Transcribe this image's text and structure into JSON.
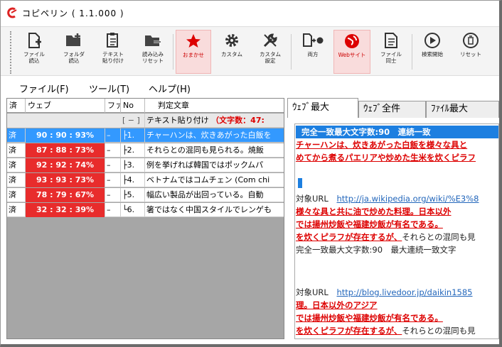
{
  "window": {
    "title": "コピペリン ( 1.1.000 )"
  },
  "ribbon": [
    {
      "name": "file-import-button",
      "icon": "file-plus",
      "label": "ファイル\n読込",
      "active": false
    },
    {
      "name": "folder-import-button",
      "icon": "folder-plus",
      "label": "フォルダ\n読込",
      "active": false
    },
    {
      "name": "text-paste-button",
      "icon": "paste",
      "label": "テキスト\n貼り付け",
      "active": false
    },
    {
      "name": "reload-reset-button",
      "icon": "folder-minus",
      "label": "読み込み\nリセット",
      "active": false
    },
    {
      "name": "omakase-button",
      "icon": "star",
      "label": "おまかせ",
      "active": true
    },
    {
      "name": "custom-button",
      "icon": "gear",
      "label": "カスタム",
      "active": false
    },
    {
      "name": "custom-settings-button",
      "icon": "wrench",
      "label": "カスタム\n設定",
      "active": false
    },
    {
      "name": "both-button",
      "icon": "doc-plus-globe",
      "label": "両方",
      "active": false
    },
    {
      "name": "website-button",
      "icon": "globe",
      "label": "Webサイト",
      "active": true
    },
    {
      "name": "file-to-file-button",
      "icon": "document",
      "label": "ファイル\n同士",
      "active": false
    },
    {
      "name": "start-check-button",
      "icon": "play",
      "label": "検索開始",
      "active": false
    },
    {
      "name": "reset-button",
      "icon": "trash",
      "label": "リセット",
      "active": false
    }
  ],
  "menu": {
    "file": "ファイル(F)",
    "tools": "ツール(T)",
    "help": "ヘルプ(H)"
  },
  "grid": {
    "headers": {
      "status": "済",
      "web": "ウェブ",
      "file": "ファ",
      "no": "No",
      "text": "判定文章"
    },
    "group_row": {
      "toggle": "[ − ]",
      "label": "テキスト貼り付け",
      "count": "（文字数：47:"
    },
    "rows": [
      {
        "status": "済",
        "pct": "90 : 90 : 93%",
        "file": "–",
        "no": "├1.",
        "text": "チャーハンは、炊きあがった白飯を"
      },
      {
        "status": "済",
        "pct": "87 : 88 : 73%",
        "file": "–",
        "no": "├2.",
        "text": "それらとの混同も見られる。焼飯"
      },
      {
        "status": "済",
        "pct": "92 : 92 : 74%",
        "file": "–",
        "no": "├3.",
        "text": "例を挙げれば韓国ではポックムパ"
      },
      {
        "status": "済",
        "pct": "93 : 93 : 73%",
        "file": "–",
        "no": "├4.",
        "text": "ベトナムではコムチェン (Com chi"
      },
      {
        "status": "済",
        "pct": "78 : 79 : 67%",
        "file": "–",
        "no": "├5.",
        "text": "幅広い製品が出回っている。自動"
      },
      {
        "status": "済",
        "pct": "32 : 32 : 39%",
        "file": "–",
        "no": "└6.",
        "text": "箸ではなく中国スタイルでレンゲも"
      }
    ]
  },
  "tabs": [
    "ｳｪﾌﾞ最大",
    "ｳｪﾌﾞ全件",
    "ﾌｧｲﾙ最大"
  ],
  "content": {
    "header": "完全一致最大文字数:90　連続一致",
    "l1": "チャーハンは、炊きあがった白飯を様々な具と",
    "l2": "めてから煮るパエリアや炒めた生米を炊くピラフ",
    "url_label_1": "対象URL",
    "url_1": "http://ja.wikipedia.org/wiki/%E3%8",
    "l3": "様々な具と共に油で炒めた料理。日本以外",
    "l4": "では揚州炒飯や福建炒飯が有名である。",
    "l5a": "を炊くピラフが存在するが、",
    "l5b": "それらとの混同も見",
    "l6": "完全一致最大文字数:90　最大連続一致文字",
    "url_label_2": "対象URL",
    "url_2": "http://blog.livedoor.jp/daikin1585",
    "l7": "理。日本以外のアジア",
    "l8": "では揚州炒飯や福建炒飯が有名である。",
    "l9a": "を炊くピラフが存在するが、",
    "l9b": "それらとの混同も見"
  },
  "colors": {
    "accent": "#e82c2c",
    "selected": "#3399ff",
    "header_blue": "#1d7fe0"
  }
}
